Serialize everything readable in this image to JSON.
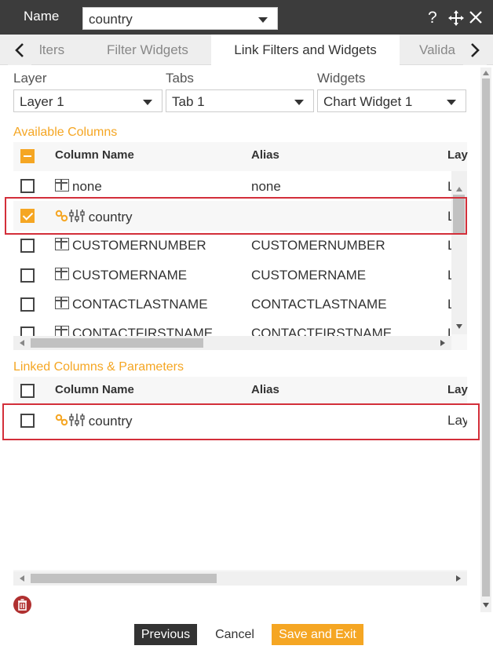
{
  "header": {
    "name_label": "Name",
    "name_value": "country",
    "help_icon": "question-icon",
    "move_icon": "move-icon",
    "close_icon": "close-icon"
  },
  "tabs": {
    "items": [
      {
        "label": "lters"
      },
      {
        "label": "Filter Widgets"
      },
      {
        "label": "Link Filters and Widgets",
        "active": true
      },
      {
        "label": "Valida"
      }
    ]
  },
  "selectors": {
    "layer": {
      "label": "Layer",
      "value": "Layer 1"
    },
    "tabs": {
      "label": "Tabs",
      "value": "Tab 1"
    },
    "widgets": {
      "label": "Widgets",
      "value": "Chart Widget 1"
    }
  },
  "available": {
    "title": "Available Columns",
    "headers": {
      "name": "Column Name",
      "alias": "Alias",
      "layer": "Lay"
    },
    "rows": [
      {
        "name": "none",
        "alias": "none",
        "layer": "L",
        "checked": false,
        "icon": "column-icon"
      },
      {
        "name": "country",
        "alias": "",
        "layer": "L",
        "checked": true,
        "icon": "link-filter-icon"
      },
      {
        "name": "CUSTOMERNUMBER",
        "alias": "CUSTOMERNUMBER",
        "layer": "L",
        "checked": false,
        "icon": "column-icon"
      },
      {
        "name": "CUSTOMERNAME",
        "alias": "CUSTOMERNAME",
        "layer": "L",
        "checked": false,
        "icon": "column-icon"
      },
      {
        "name": "CONTACTLASTNAME",
        "alias": "CONTACTLASTNAME",
        "layer": "L",
        "checked": false,
        "icon": "column-icon"
      },
      {
        "name": "CONTACTFIRSTNAME",
        "alias": "CONTACTFIRSTNAME",
        "layer": "L",
        "checked": false,
        "icon": "column-icon"
      }
    ]
  },
  "linked": {
    "title": "Linked Columns & Parameters",
    "headers": {
      "name": "Column Name",
      "alias": "Alias",
      "layer": "Lay"
    },
    "rows": [
      {
        "name": "country",
        "alias": "",
        "layer": "Lay",
        "checked": false,
        "icon": "link-filter-icon"
      }
    ]
  },
  "footer": {
    "previous": "Previous",
    "cancel": "Cancel",
    "save": "Save and Exit"
  },
  "colors": {
    "accent": "#f5a623",
    "highlight": "#d32f3a",
    "titlebar": "#3c3c3c",
    "delete": "#b03030"
  }
}
